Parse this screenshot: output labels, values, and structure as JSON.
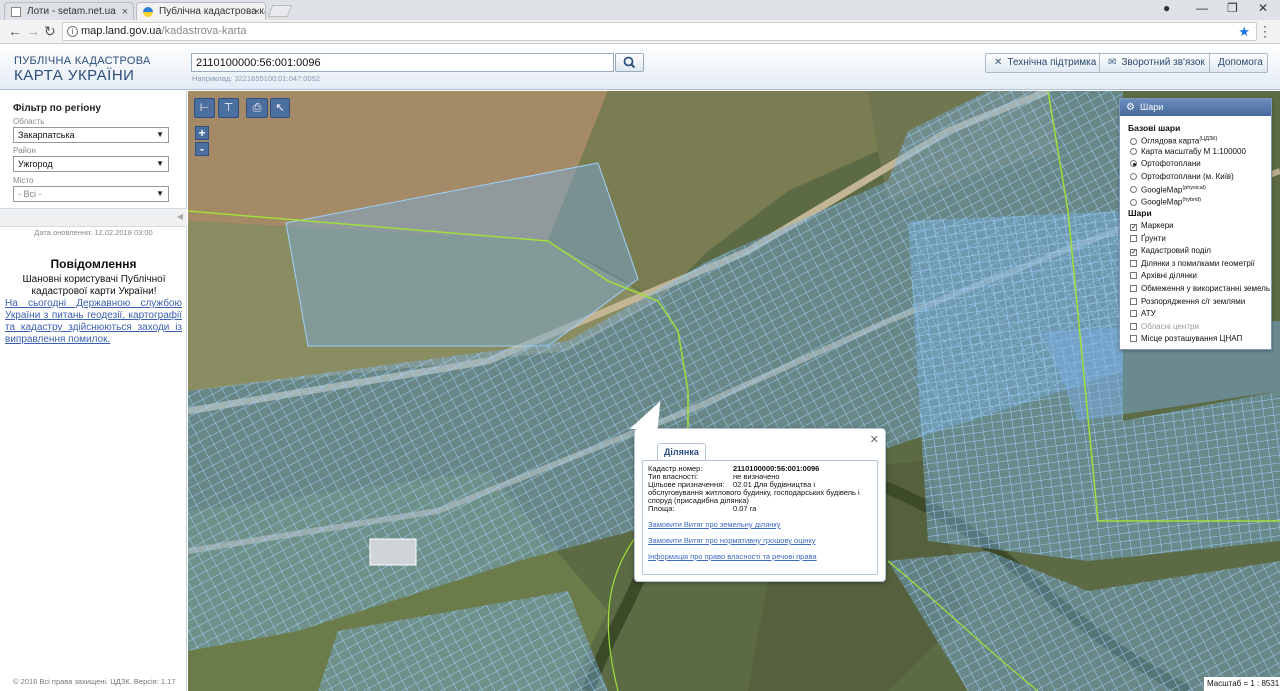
{
  "browser": {
    "tabs": [
      {
        "label": "Лоти - setam.net.ua",
        "active": false
      },
      {
        "label": "Публічна кадастрова ка",
        "active": true
      }
    ],
    "url_host": "map.land.gov.ua",
    "url_path": "/kadastrova-karta",
    "win_min": "—",
    "win_max": "❐",
    "win_close": "✕"
  },
  "header": {
    "brand_line1": "ПУБЛІЧНА КАДАСТРОВА",
    "brand_line2": "КАРТА УКРАЇНИ",
    "search_value": "2110100000:56:001:0096",
    "search_hint": "Наприклад: 3221655100:01:047:0052",
    "buttons": {
      "support": "Технічна підтримка",
      "feedback": "Зворотний зв'язок",
      "help": "Допомога"
    }
  },
  "sidebar": {
    "filter_title": "Фільтр по регіону",
    "oblast_label": "Область",
    "oblast_value": "Закарпатська",
    "rayon_label": "Район",
    "rayon_value": "Ужгород",
    "city_label": "Місто",
    "city_value": "- Всі -",
    "updated": "Дата оновлення: 12.02.2018 03:00",
    "notice_title": "Повідомлення",
    "notice_text": "Шановні користувачі Публічної кадастрової карти України!",
    "notice_link": "На сьогодні Державною службою України з питань геодезії, картографії та кадастру здійснюються заходи із виправлення помилок.",
    "copyright": "© 2016 Всі права захищені. ЦДЗК. Версія: 1.17"
  },
  "map_tools": {
    "zoom_in": "+",
    "zoom_out": "-"
  },
  "layers_panel": {
    "title": "Шари",
    "base_title": "Базові шари",
    "base": [
      {
        "label": "Оглядова карта",
        "sup": "(ЦДЗК)",
        "selected": false
      },
      {
        "label": "Карта масштабу М 1:100000",
        "sup": "",
        "selected": false
      },
      {
        "label": "Ортофотоплани",
        "sup": "",
        "selected": true
      },
      {
        "label": "Ортофотоплани (м. Київ)",
        "sup": "",
        "selected": false
      },
      {
        "label": "GoogleMap",
        "sup": "(physical)",
        "selected": false
      },
      {
        "label": "GoogleMap",
        "sup": "(hybrid)",
        "selected": false
      }
    ],
    "layers_title": "Шари",
    "layers": [
      {
        "label": "Маркери",
        "checked": true
      },
      {
        "label": "Ґрунти",
        "checked": false
      },
      {
        "label": "Кадастровий поділ",
        "checked": true
      },
      {
        "label": "Ділянки з помилками геометрії",
        "checked": false
      },
      {
        "label": "Архівні ділянки",
        "checked": false
      },
      {
        "label": "Обмеження у використанні земель",
        "checked": false
      },
      {
        "label": "Розпорядження с/г землями",
        "checked": false
      },
      {
        "label": "АТУ",
        "checked": false
      },
      {
        "label": "Обласні центри",
        "checked": false,
        "disabled": true
      },
      {
        "label": "Місце розташування ЦНАП",
        "checked": false
      }
    ]
  },
  "popup": {
    "tab": "Ділянка",
    "cad_label": "Кадастр.номер:",
    "cad_value": "2110100000:56:001:0096",
    "own_label": "Тип власності:",
    "own_value": "не визначено",
    "purpose_label": "Цільове призначення:",
    "purpose_value": "02.01 Для будівництва і",
    "purpose_cont": "обслуговування житлового будинку, господарських будівель і споруд (присадибна ділянка)",
    "area_label": "Площа:",
    "area_value": "0.07 га",
    "link1": "Замовити Витяг про земельну ділянку",
    "link2": "Замовити Витяг про нормативну грошову оцінку",
    "link3": "Інформація про право власності та речові права"
  },
  "scale": "Масштаб = 1 : 8531",
  "colors": {
    "accent": "#2c4d7a",
    "parcel_stroke": "#8ec4f2",
    "boundary": "#9fe03a"
  }
}
